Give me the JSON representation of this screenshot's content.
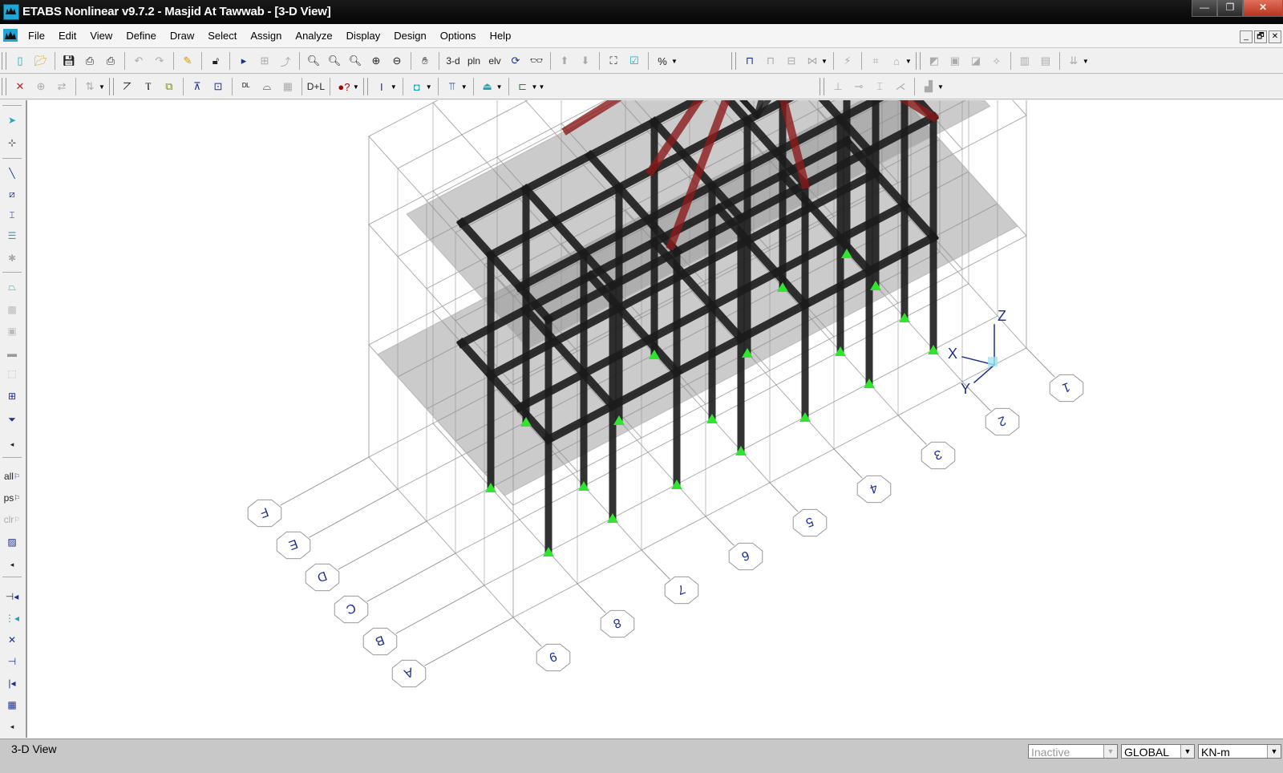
{
  "window": {
    "title": "ETABS Nonlinear v9.7.2 - Masjid At Tawwab - [3-D View]",
    "buttons": {
      "minimize": "—",
      "restore": "❐",
      "close": "✕"
    },
    "mdi_buttons": {
      "minimize": "_",
      "restore": "🗗",
      "close": "✕"
    }
  },
  "menu": {
    "items": [
      {
        "label": "File"
      },
      {
        "label": "Edit"
      },
      {
        "label": "View"
      },
      {
        "label": "Define"
      },
      {
        "label": "Draw"
      },
      {
        "label": "Select"
      },
      {
        "label": "Assign"
      },
      {
        "label": "Analyze"
      },
      {
        "label": "Display"
      },
      {
        "label": "Design"
      },
      {
        "label": "Options"
      },
      {
        "label": "Help"
      }
    ]
  },
  "toolbar1": {
    "view_3d": "3-d",
    "view_plan": "pln",
    "view_elev": "elv",
    "icons": [
      "new-model",
      "open",
      "save",
      "print-graphics",
      "print-tables",
      "undo",
      "redo",
      "refresh",
      "lock",
      "run-analysis",
      "run-construction",
      "run-nonlinear",
      "rubber-band-zoom",
      "restore-full-view",
      "previous-zoom",
      "zoom-in",
      "zoom-out",
      "pan",
      "3d-view",
      "plan-view",
      "elevation-view",
      "rotate-3d",
      "perspective",
      "move-up",
      "move-down",
      "set-building-view",
      "set-display-options",
      "assign-percent",
      "frame-forces",
      "deformed-shape",
      "virtual-work",
      "mode-shape",
      "show-undeformed",
      "show-loads",
      "show-results",
      "steel-frame-design",
      "concrete-design",
      "composite-design",
      "steel-joist-design",
      "shear-wall-design",
      "pier",
      "spandrel",
      "response-spectrum"
    ]
  },
  "toolbar2": {
    "icons": [
      "select-joints",
      "joint-restraints",
      "joint-springs",
      "diaphragms",
      "section-properties",
      "frame-sections",
      "wall-slab-deck",
      "static-load-cases",
      "time-history",
      "load-combo",
      "design-combo",
      "ei-combo",
      "check-model",
      "display-frame",
      "display-area",
      "display-i-beam",
      "display-link",
      "display-column"
    ]
  },
  "left_toolbar": {
    "all_label": "all",
    "ps_label": "ps",
    "clr_label": "clr"
  },
  "grid_labels": {
    "numeric": [
      "1",
      "2",
      "3",
      "4",
      "5",
      "6",
      "7",
      "8",
      "9"
    ],
    "alpha": [
      "A",
      "B",
      "C",
      "D",
      "E",
      "F"
    ]
  },
  "axes": {
    "x": "X",
    "y": "Y",
    "z": "Z"
  },
  "status": {
    "view_name": "3-D View",
    "inactive_placeholder": "Inactive",
    "coord_system": "GLOBAL",
    "units": "KN-m"
  },
  "colors": {
    "frame": "#1c1c1c",
    "roof_rafter": "#8b1a1a",
    "support": "#2ee62e",
    "grid": "#9a9a9a",
    "label": "#1b2f8f",
    "slab": "#8c8c8c"
  }
}
